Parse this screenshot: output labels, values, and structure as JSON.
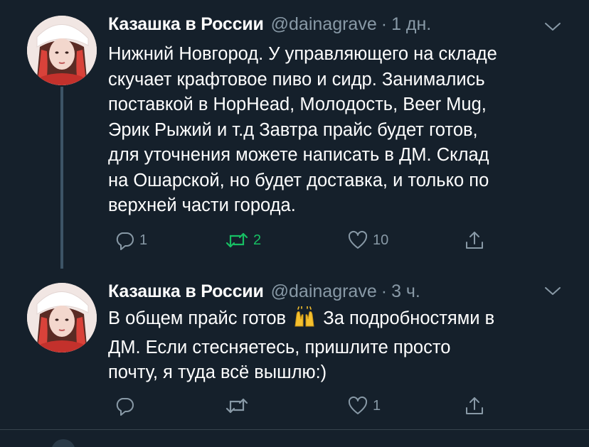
{
  "tweets": [
    {
      "author": "Казашка в России",
      "handle": "@dainagrave",
      "separator": "·",
      "time": "1 дн.",
      "text": "Нижний Новгород. У управляющего на складе\nскучает крафтовое пиво и сидр. Занимались\nпоставкой в HopHead, Молодость, Beer Mug,\nЭрик Рыжий и т.д Завтра прайс будет готов,\nдля уточнения можете написать в ДМ. Склад\nна Ошарской, но будет доставка, и только по\nверхней части города.",
      "reply_count": "1",
      "retweet_count": "2",
      "like_count": "10"
    },
    {
      "author": "Казашка в России",
      "handle": "@dainagrave",
      "separator": "·",
      "time": "3 ч.",
      "text_part1": "В общем прайс готов ",
      "emoji": "raised-hands",
      "text_part2": " За подробностями в\nДМ. Если стесняетесь, пришлите просто\nпочту, я туда всё вышлю:)",
      "reply_count": "",
      "retweet_count": "",
      "like_count": "1"
    }
  ],
  "colors": {
    "background": "#15202b",
    "text": "#ffffff",
    "muted": "#8899a6",
    "retweet_active": "#17bf63",
    "divider": "#38444d",
    "thread_line": "#3d5466"
  }
}
